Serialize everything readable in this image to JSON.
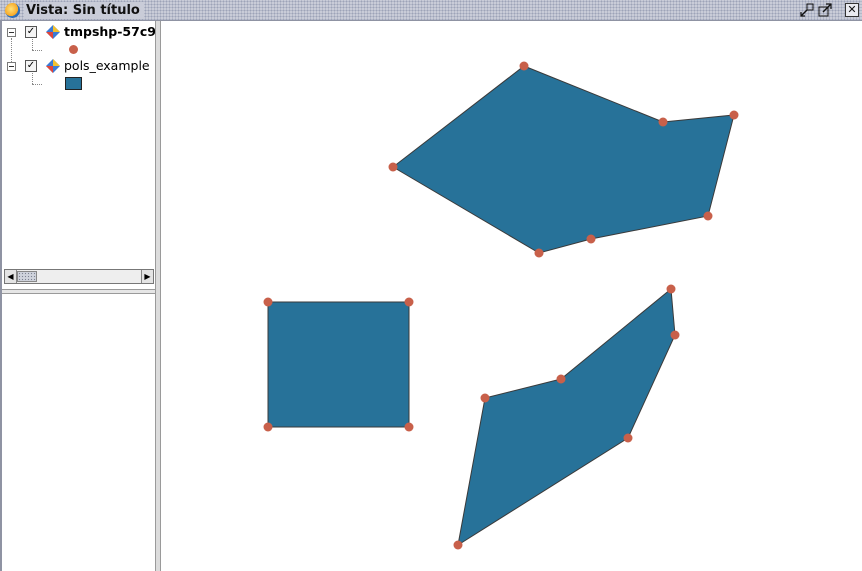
{
  "window": {
    "title": "Vista: Sin título",
    "controls": [
      "restore-icon",
      "maximize-icon",
      "close-icon"
    ],
    "close_glyph": "✕"
  },
  "toc": {
    "layers": [
      {
        "name": "tmpshp-57c9",
        "checked": true,
        "bold": true,
        "legend": "point-symbol"
      },
      {
        "name": "pols_example",
        "checked": true,
        "bold": false,
        "legend": "polygon-symbol"
      }
    ],
    "check_glyph": "✓"
  },
  "scrollbar": {
    "left_glyph": "◀",
    "right_glyph": "▶"
  },
  "colors": {
    "polygon_fill": "#277299",
    "polygon_stroke": "#3a3a3a",
    "vertex": "#c8604a",
    "title_bg": "#c9ccd8"
  },
  "map": {
    "polygons": [
      {
        "name": "hexagon-polygon",
        "points": [
          [
            393,
            167
          ],
          [
            524,
            66
          ],
          [
            663,
            122
          ],
          [
            734,
            115
          ],
          [
            708,
            216
          ],
          [
            591,
            239
          ],
          [
            539,
            253
          ]
        ]
      },
      {
        "name": "square-polygon",
        "points": [
          [
            268,
            302
          ],
          [
            409,
            302
          ],
          [
            409,
            427
          ],
          [
            268,
            427
          ]
        ]
      },
      {
        "name": "diamond-polygon",
        "points": [
          [
            485,
            398
          ],
          [
            561,
            379
          ],
          [
            671,
            289
          ],
          [
            675,
            335
          ],
          [
            628,
            438
          ],
          [
            458,
            545
          ]
        ]
      }
    ]
  }
}
